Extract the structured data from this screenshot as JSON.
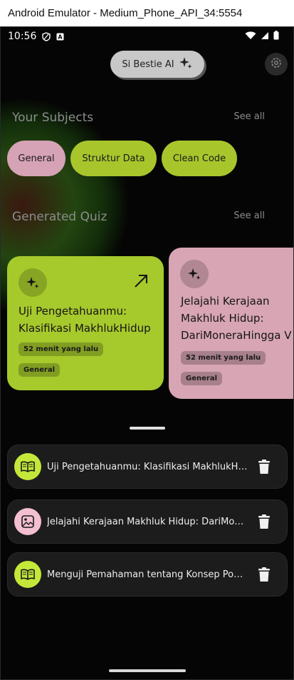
{
  "window": {
    "title": "Android Emulator - Medium_Phone_API_34:5554"
  },
  "status_bar": {
    "time": "10:56",
    "icons": [
      "shield-icon",
      "a-box-icon",
      "wifi-icon",
      "signal-icon",
      "battery-icon"
    ]
  },
  "header": {
    "bestie_label": "Si Bestie AI",
    "bestie_icon": "sparkle-icon",
    "settings_icon": "gear-icon"
  },
  "subjects": {
    "title": "Your Subjects",
    "see_all": "See all",
    "chips": [
      {
        "label": "General",
        "color": "#d6a3b6"
      },
      {
        "label": "Struktur Data",
        "color": "#a8c62c"
      },
      {
        "label": "Clean Code",
        "color": "#a8c62c"
      }
    ]
  },
  "quiz": {
    "title": "Generated Quiz",
    "see_all": "See all",
    "cards": [
      {
        "title_line1": "Uji Pengetahuanmu:",
        "title_line2": "Klasifikasi MakhlukHidup",
        "time": "52 menit yang lalu",
        "subject": "General",
        "color": "#a6c92c"
      },
      {
        "title_line1": "Jelajahi Kerajaan",
        "title_line2": "Makhluk Hidup:",
        "title_line3": "DariMoneraHingga V",
        "time": "52 menit yang lalu",
        "subject": "General",
        "color": "#d7a5b4"
      }
    ]
  },
  "history": [
    {
      "text": "Uji Pengetahuanmu: Klasifikasi MakhlukHidup",
      "icon": "book-icon",
      "icon_bg": "#c4e83a"
    },
    {
      "text": "Jelajahi Kerajaan Makhluk Hidup: DariMonera Hingga V",
      "icon": "image-icon",
      "icon_bg": "#f4bfd0"
    },
    {
      "text": "Menguji Pemahaman tentang Konsep Pohon",
      "icon": "book-icon",
      "icon_bg": "#c4e83a"
    }
  ]
}
